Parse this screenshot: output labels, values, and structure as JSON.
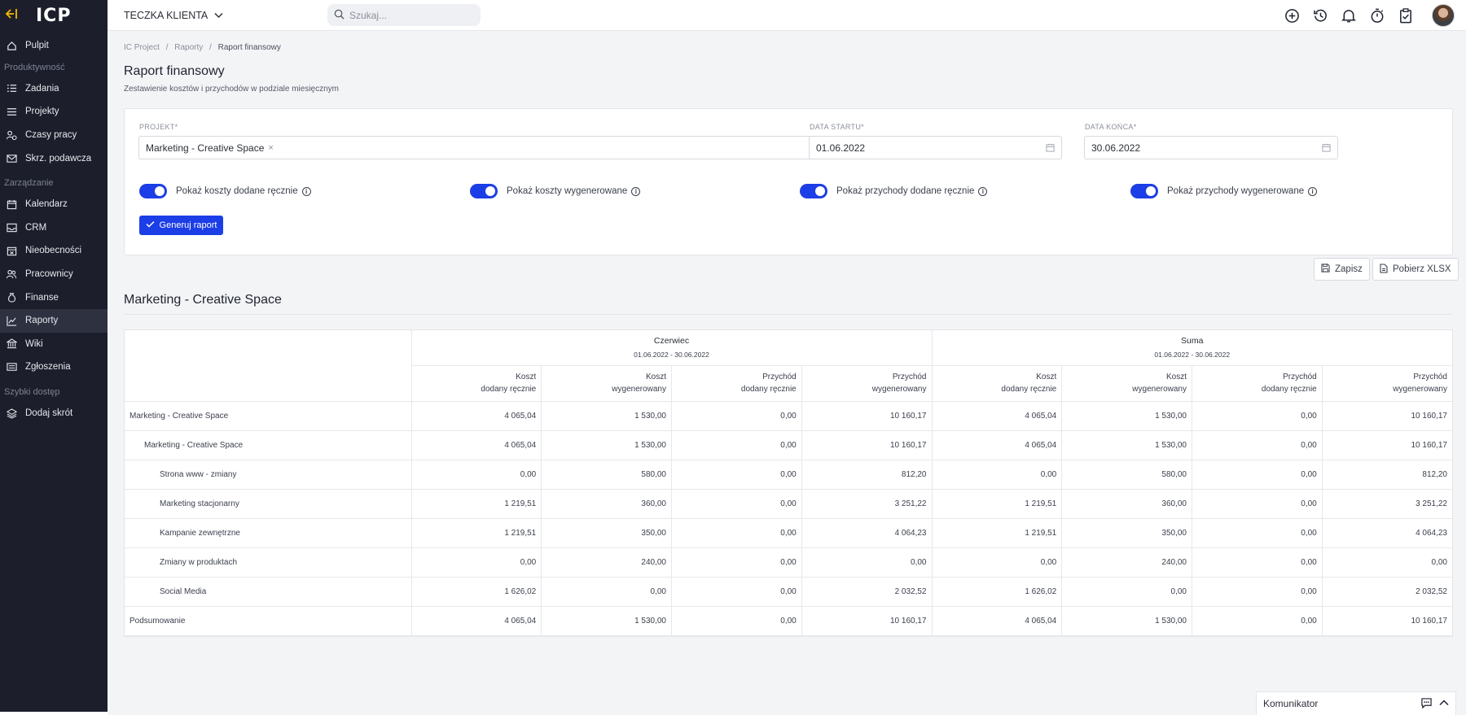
{
  "sidebar": {
    "logo": "ICP",
    "sections": {
      "produktywnosc": "Produktywność",
      "zarzadzanie": "Zarządzanie",
      "szybki": "Szybki dostęp"
    },
    "items": {
      "pulpit": "Pulpit",
      "zadania": "Zadania",
      "projekty": "Projekty",
      "czasy": "Czasy pracy",
      "skrz": "Skrz. podawcza",
      "kalendarz": "Kalendarz",
      "crm": "CRM",
      "nieobecnosci": "Nieobecności",
      "pracownicy": "Pracownicy",
      "finanse": "Finanse",
      "raporty": "Raporty",
      "wiki": "Wiki",
      "zgloszenia": "Zgłoszenia",
      "dodaj": "Dodaj skrót"
    },
    "active": "raporty"
  },
  "topbar": {
    "client": "TECZKA KLIENTA",
    "search_placeholder": "Szukaj..."
  },
  "breadcrumb": {
    "a": "IC Project",
    "b": "Raporty",
    "c": "Raport finansowy",
    "sep": "/"
  },
  "page": {
    "title": "Raport finansowy",
    "subtitle": "Zestawienie kosztów i przychodów w podziale miesięcznym"
  },
  "filters": {
    "project_label": "PROJEKT",
    "project_value": "Marketing - Creative Space",
    "start_label": "DATA STARTU",
    "start_value": "01.06.2022",
    "end_label": "DATA KOŃCA",
    "end_value": "30.06.2022",
    "required_mark": "*",
    "toggles": {
      "t1": "Pokaż koszty dodane ręcznie",
      "t2": "Pokaż koszty wygenerowane",
      "t3": "Pokaż przychody dodane ręcznie",
      "t4": "Pokaż przychody wygenerowane"
    },
    "generate_label": "Generuj raport"
  },
  "actions": {
    "save": "Zapisz",
    "download": "Pobierz XLSX"
  },
  "report": {
    "title": "Marketing - Creative Space",
    "groups": [
      {
        "name": "Czerwiec",
        "range": "01.06.2022  -  30.06.2022"
      },
      {
        "name": "Suma",
        "range": "01.06.2022  -  30.06.2022"
      }
    ],
    "columns": [
      [
        "Koszt",
        "dodany ręcznie"
      ],
      [
        "Koszt",
        "wygenerowany"
      ],
      [
        "Przychód",
        "dodany ręcznie"
      ],
      [
        "Przychód",
        "wygenerowany"
      ],
      [
        "Koszt",
        "dodany ręcznie"
      ],
      [
        "Koszt",
        "wygenerowany"
      ],
      [
        "Przychód",
        "dodany ręcznie"
      ],
      [
        "Przychód",
        "wygenerowany"
      ]
    ],
    "rows": [
      {
        "name": "Marketing - Creative Space",
        "level": 0,
        "values": [
          "4 065,04",
          "1 530,00",
          "0,00",
          "10 160,17",
          "4 065,04",
          "1 530,00",
          "0,00",
          "10 160,17"
        ]
      },
      {
        "name": "Marketing - Creative Space",
        "level": 1,
        "values": [
          "4 065,04",
          "1 530,00",
          "0,00",
          "10 160,17",
          "4 065,04",
          "1 530,00",
          "0,00",
          "10 160,17"
        ]
      },
      {
        "name": "Strona www - zmiany",
        "level": 2,
        "values": [
          "0,00",
          "580,00",
          "0,00",
          "812,20",
          "0,00",
          "580,00",
          "0,00",
          "812,20"
        ]
      },
      {
        "name": "Marketing stacjonarny",
        "level": 2,
        "values": [
          "1 219,51",
          "360,00",
          "0,00",
          "3 251,22",
          "1 219,51",
          "360,00",
          "0,00",
          "3 251,22"
        ]
      },
      {
        "name": "Kampanie zewnętrzne",
        "level": 2,
        "values": [
          "1 219,51",
          "350,00",
          "0,00",
          "4 064,23",
          "1 219,51",
          "350,00",
          "0,00",
          "4 064,23"
        ]
      },
      {
        "name": "Zmiany w produktach",
        "level": 2,
        "values": [
          "0,00",
          "240,00",
          "0,00",
          "0,00",
          "0,00",
          "240,00",
          "0,00",
          "0,00"
        ]
      },
      {
        "name": "Social Media",
        "level": 2,
        "values": [
          "1 626,02",
          "0,00",
          "0,00",
          "2 032,52",
          "1 626,02",
          "0,00",
          "0,00",
          "2 032,52"
        ]
      },
      {
        "name": "Podsumowanie",
        "level": 0,
        "values": [
          "4 065,04",
          "1 530,00",
          "0,00",
          "10 160,17",
          "4 065,04",
          "1 530,00",
          "0,00",
          "10 160,17"
        ]
      }
    ]
  },
  "komunikator": {
    "label": "Komunikator"
  },
  "colors": {
    "sidebar_bg": "#1c1f2b",
    "accent": "#1c3ee6",
    "back_arrow": "#f5b800"
  }
}
